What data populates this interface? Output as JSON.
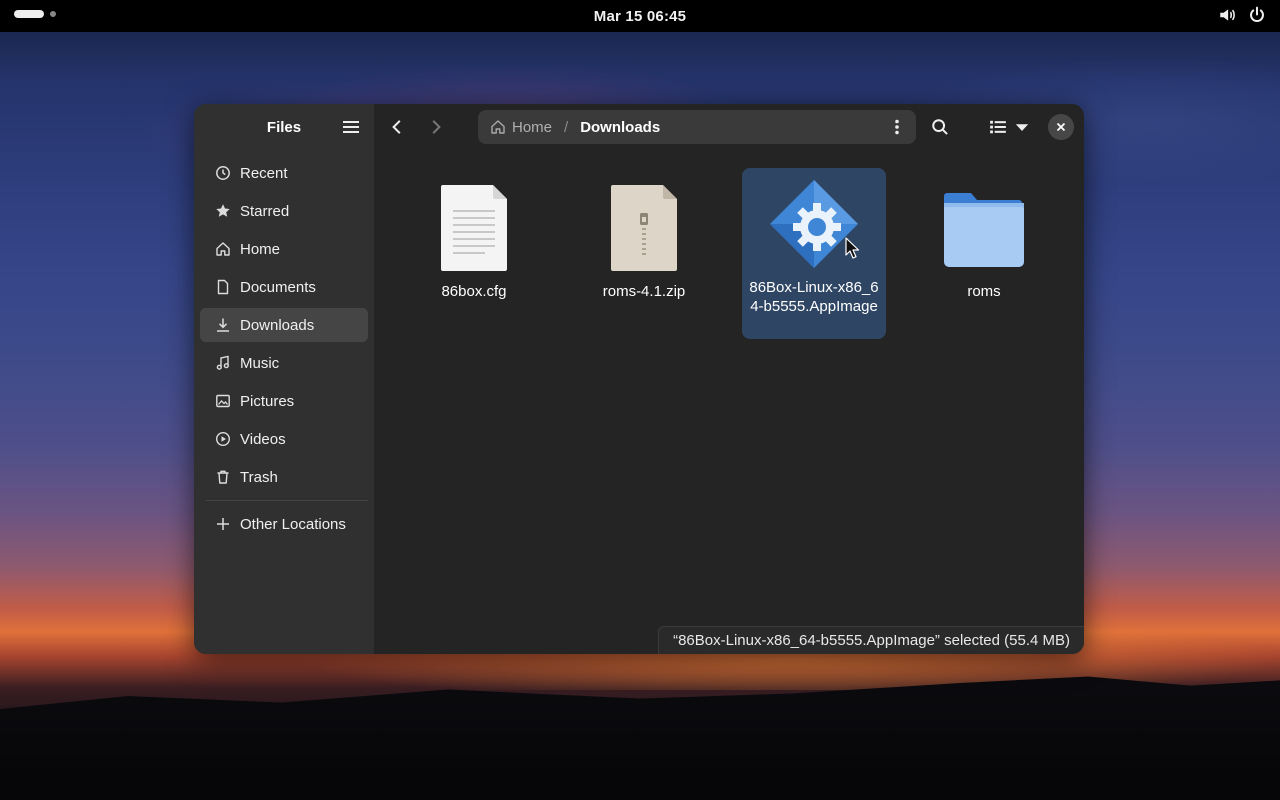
{
  "topbar": {
    "clock": "Mar 15  06:45",
    "icons": [
      "activities-icon",
      "volume-icon",
      "power-icon"
    ]
  },
  "window": {
    "sidebar": {
      "title": "Files",
      "menu_icon": "hamburger-menu-icon",
      "places": [
        {
          "label": "Recent",
          "icon": "clock-icon"
        },
        {
          "label": "Starred",
          "icon": "star-icon"
        },
        {
          "label": "Home",
          "icon": "home-icon"
        },
        {
          "label": "Documents",
          "icon": "document-icon"
        },
        {
          "label": "Downloads",
          "icon": "download-icon",
          "active": true
        },
        {
          "label": "Music",
          "icon": "music-icon"
        },
        {
          "label": "Pictures",
          "icon": "picture-icon"
        },
        {
          "label": "Videos",
          "icon": "video-icon"
        },
        {
          "label": "Trash",
          "icon": "trash-icon"
        }
      ],
      "other_locations": {
        "label": "Other Locations",
        "icon": "plus-icon"
      }
    },
    "toolbar": {
      "back_icon": "chevron-left-icon",
      "forward_icon": "chevron-right-icon",
      "path": {
        "home": "Home",
        "separator": "/",
        "current": "Downloads"
      },
      "path_menu_icon": "kebab-menu-icon",
      "search_icon": "search-icon",
      "view_icon": "list-view-icon",
      "view_dropdown_icon": "chevron-down-icon",
      "close_icon": "close-icon"
    },
    "files": [
      {
        "name": "86box.cfg",
        "type": "text"
      },
      {
        "name": "roms-4.1.zip",
        "type": "archive"
      },
      {
        "name": "86Box-Linux-x86_64-b5555.AppImage",
        "type": "appimage",
        "selected": true
      },
      {
        "name": "roms",
        "type": "folder"
      }
    ],
    "status": "“86Box-Linux-x86_64-b5555.AppImage” selected  (55.4 MB)"
  },
  "colors": {
    "window_bg": "#242424",
    "sidebar_bg": "#303030",
    "selection": "#2e4563",
    "accent": "#3584e4"
  }
}
